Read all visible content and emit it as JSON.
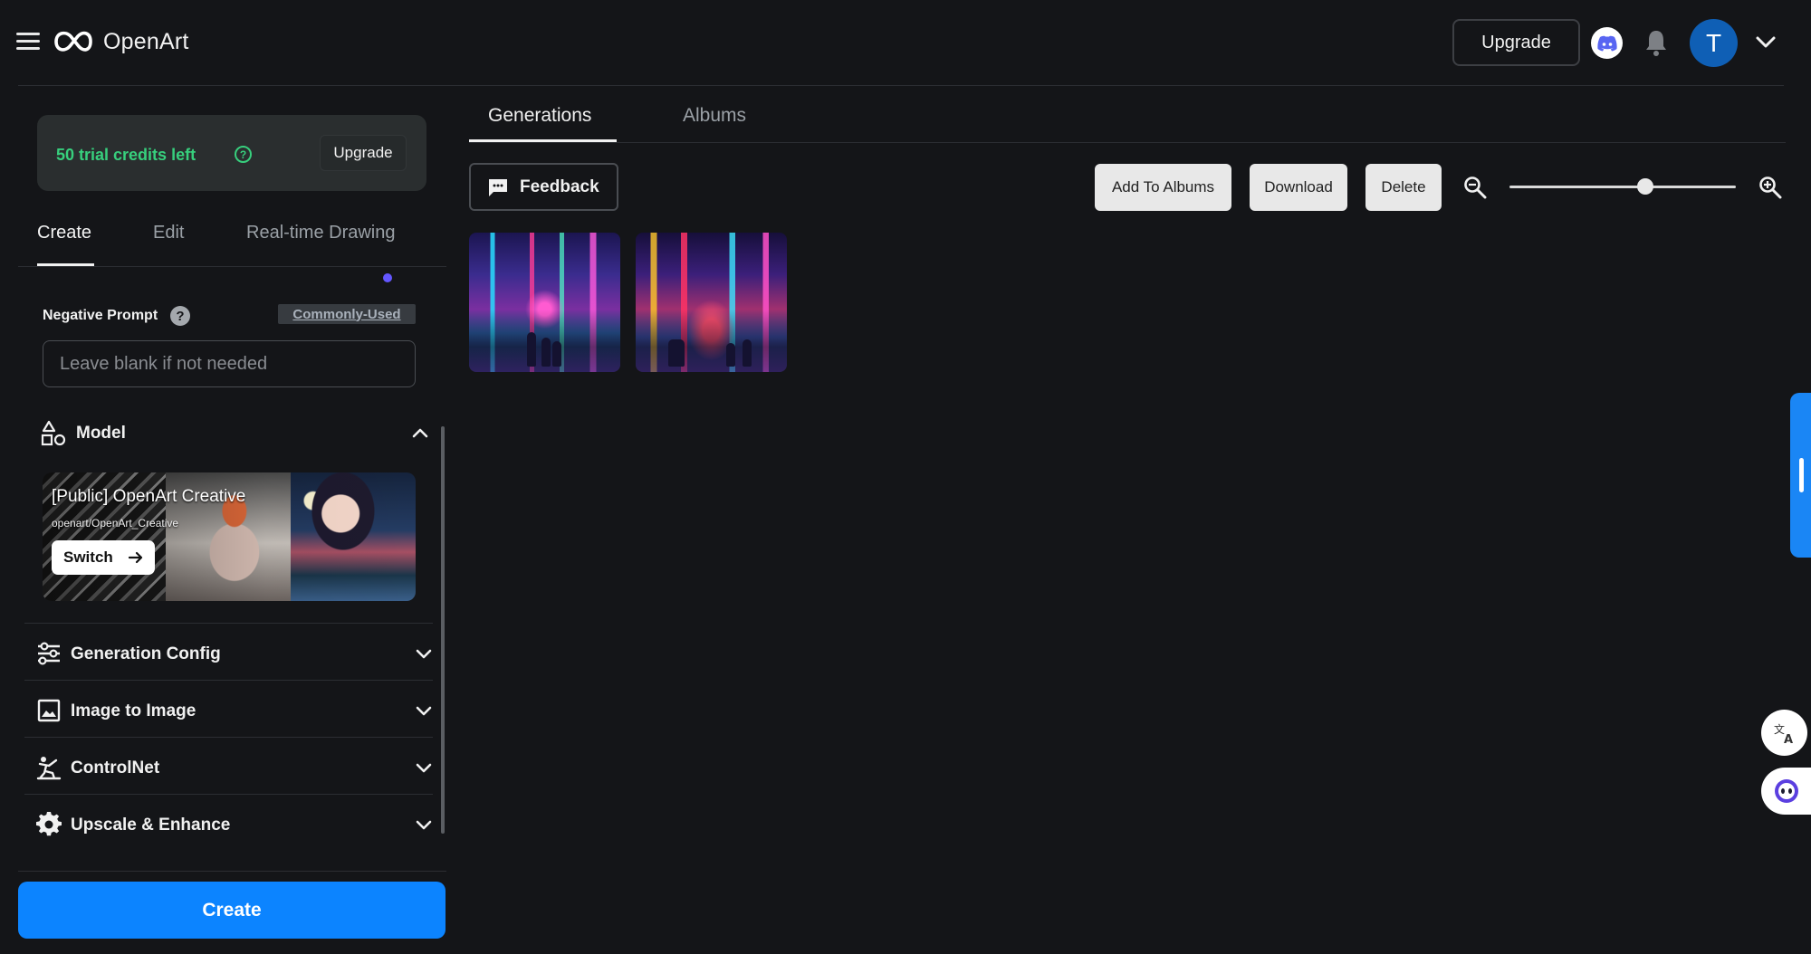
{
  "header": {
    "brand": "OpenArt",
    "upgrade_label": "Upgrade",
    "avatar_initial": "T",
    "accent": "#0c84ff"
  },
  "sidebar": {
    "credits_text": "50 trial credits left",
    "credits_upgrade": "Upgrade",
    "tabs": [
      {
        "label": "Create",
        "active": true
      },
      {
        "label": "Edit",
        "active": false
      },
      {
        "label": "Real-time Drawing",
        "active": false
      }
    ],
    "negative_prompt": {
      "label": "Negative Prompt",
      "commonly_used": "Commonly-Used",
      "placeholder": "Leave blank if not needed",
      "value": ""
    },
    "model": {
      "section_label": "Model",
      "name": "[Public] OpenArt Creative",
      "slug": "openart/OpenArt_Creative",
      "switch_label": "Switch"
    },
    "sections": [
      {
        "label": "Generation Config",
        "icon": "sliders-icon"
      },
      {
        "label": "Image to Image",
        "icon": "image-icon"
      },
      {
        "label": "ControlNet",
        "icon": "pose-icon"
      },
      {
        "label": "Upscale & Enhance",
        "icon": "gear-icon"
      }
    ],
    "create_label": "Create"
  },
  "main": {
    "tabs": [
      {
        "label": "Generations",
        "active": true
      },
      {
        "label": "Albums",
        "active": false
      }
    ],
    "feedback_label": "Feedback",
    "actions": {
      "add_to_albums": "Add To Albums",
      "download": "Download",
      "delete": "Delete"
    },
    "zoom_level": 0.6,
    "images": [
      {
        "alt": "cyberpunk street generation 1"
      },
      {
        "alt": "cyberpunk street generation 2"
      }
    ]
  }
}
